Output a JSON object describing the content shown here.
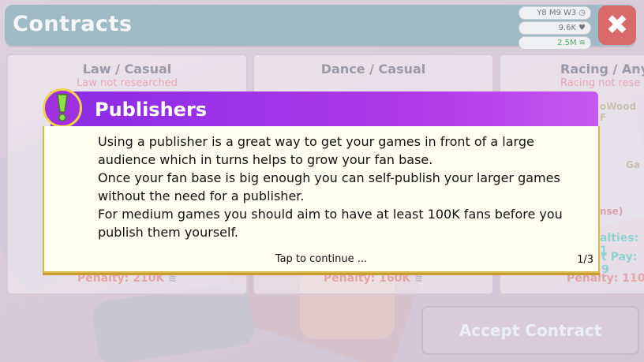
{
  "screen": {
    "title": "Contracts",
    "close_label": "✖"
  },
  "stats": {
    "date": "Y8 M9 W3",
    "fans": "9.6K",
    "money": "2.5M"
  },
  "contracts": [
    {
      "title": "Law / Casual",
      "note": "Law not researched",
      "penalty": "Penalty: 210K"
    },
    {
      "title": "Dance / Casual",
      "note": "",
      "penalty": "Penalty: 160K"
    },
    {
      "title": "Racing / Any",
      "note": "Racing not rese",
      "penalty": "Penalty: 110"
    }
  ],
  "side_fragments": {
    "publisher": "oWood F",
    "genre": "Ga",
    "license": "nse)",
    "royalties": "alties: 1",
    "upfront": "t Pay: 9"
  },
  "accept_label": "Accept Contract",
  "popup": {
    "title": "Publishers",
    "lines": [
      "Using a publisher is a great way to get your games in front of a large audience which in turns helps to grow your fan base.",
      "Once your fan base is big enough you can self-publish your larger games without the need for a publisher.",
      "For medium games you should aim to have at least 100K fans before you publish them yourself."
    ],
    "continue_label": "Tap to continue ...",
    "pager": "1/3"
  },
  "colors": {
    "popup_header": "#8a2be6",
    "popup_border": "#d9b84a",
    "popup_body": "#fffff0",
    "title_bar": "#9fb9c5",
    "close_button": "#d86a6a"
  },
  "icons": [
    "clock-icon",
    "heart-icon",
    "coins-icon",
    "close-icon",
    "exclamation-icon"
  ]
}
